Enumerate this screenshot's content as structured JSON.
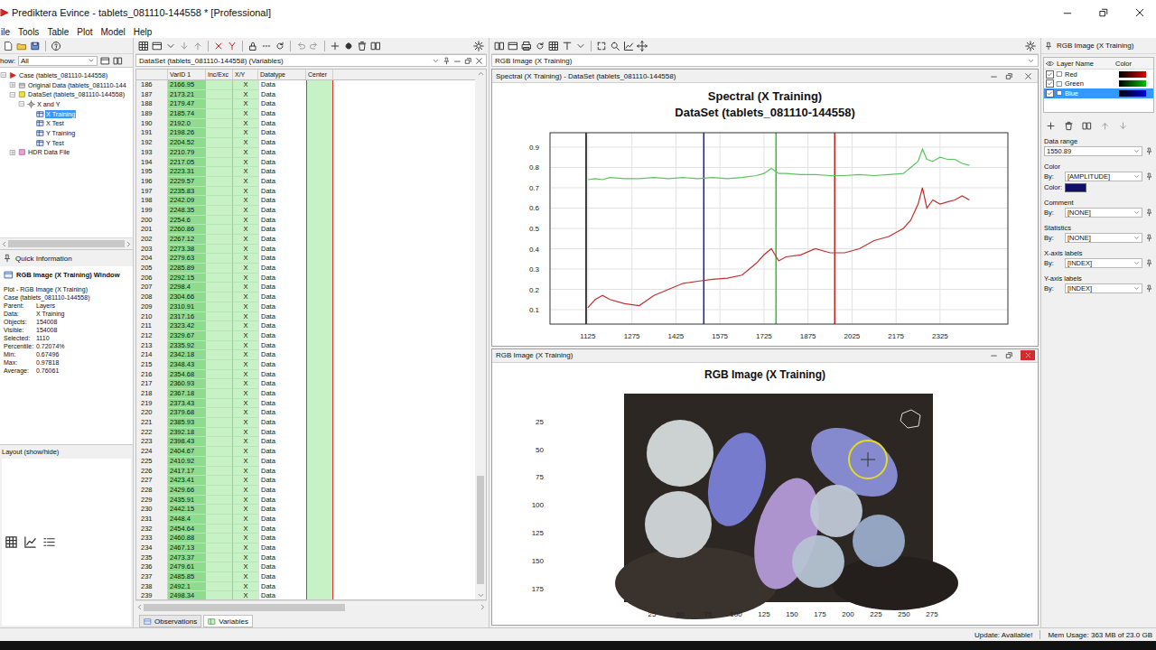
{
  "window": {
    "title": "Prediktera Evince - tablets_081110-144558 * [Professional]"
  },
  "menu": [
    "ile",
    "Tools",
    "Table",
    "Plot",
    "Model",
    "Help"
  ],
  "explorer": {
    "show_label": "how:",
    "show_value": "All",
    "tree": [
      {
        "label": "Case (tablets_081110-144558)",
        "depth": 0,
        "kind": "case",
        "expanded": true,
        "selected": false
      },
      {
        "label": "Original Data (tablets_081110-144",
        "depth": 1,
        "kind": "source",
        "expanded": false,
        "selected": false
      },
      {
        "label": "DataSet (tablets_081110-144558)",
        "depth": 1,
        "kind": "dataset",
        "expanded": true,
        "selected": false
      },
      {
        "label": "X and Y",
        "depth": 2,
        "kind": "group",
        "expanded": true,
        "selected": false
      },
      {
        "label": "X Training",
        "depth": 3,
        "kind": "matrix",
        "expanded": false,
        "selected": true
      },
      {
        "label": "X Test",
        "depth": 3,
        "kind": "matrix",
        "expanded": false,
        "selected": false
      },
      {
        "label": "Y Training",
        "depth": 3,
        "kind": "matrix",
        "expanded": false,
        "selected": false
      },
      {
        "label": "Y Test",
        "depth": 3,
        "kind": "matrix",
        "expanded": false,
        "selected": false
      },
      {
        "label": "HDR Data File",
        "depth": 1,
        "kind": "file",
        "expanded": false,
        "selected": false
      }
    ]
  },
  "quick_info": {
    "title": "Quick Information",
    "heading": "RGB Image (X Training) Window",
    "lines": [
      "Plot - RGB Image (X Training)",
      "Case (tablets_081110-144558)"
    ],
    "fields": [
      {
        "label": "Parent:",
        "value": "Layers"
      },
      {
        "label": "Data:",
        "value": "X Training"
      },
      {
        "label": "Objects:",
        "value": "154008"
      },
      {
        "label": "Visible:",
        "value": "154008"
      },
      {
        "label": "Selected:",
        "value": "1110"
      },
      {
        "label": "Percentile:",
        "value": "0.72074%"
      },
      {
        "label": "Min:",
        "value": "0.67496"
      },
      {
        "label": "Max:",
        "value": "0.97818"
      },
      {
        "label": "Average:",
        "value": "0.76061"
      }
    ]
  },
  "layout_panel": {
    "title": "Layout (show/hide)"
  },
  "grid": {
    "title": "DataSet (tablets_081110-144558) (Variables)",
    "columns": [
      "VarID 1",
      "Inc/Exc",
      "X/Y",
      "Datatype",
      "Center"
    ],
    "rows": [
      {
        "id": "186",
        "var": "2166.95",
        "xy": "X",
        "type": "Data"
      },
      {
        "id": "187",
        "var": "2173.21",
        "xy": "X",
        "type": "Data"
      },
      {
        "id": "188",
        "var": "2179.47",
        "xy": "X",
        "type": "Data"
      },
      {
        "id": "189",
        "var": "2185.74",
        "xy": "X",
        "type": "Data"
      },
      {
        "id": "190",
        "var": "2192.0",
        "xy": "X",
        "type": "Data"
      },
      {
        "id": "191",
        "var": "2198.26",
        "xy": "X",
        "type": "Data"
      },
      {
        "id": "192",
        "var": "2204.52",
        "xy": "X",
        "type": "Data"
      },
      {
        "id": "193",
        "var": "2210.79",
        "xy": "X",
        "type": "Data"
      },
      {
        "id": "194",
        "var": "2217.05",
        "xy": "X",
        "type": "Data"
      },
      {
        "id": "195",
        "var": "2223.31",
        "xy": "X",
        "type": "Data"
      },
      {
        "id": "196",
        "var": "2229.57",
        "xy": "X",
        "type": "Data"
      },
      {
        "id": "197",
        "var": "2235.83",
        "xy": "X",
        "type": "Data"
      },
      {
        "id": "198",
        "var": "2242.09",
        "xy": "X",
        "type": "Data"
      },
      {
        "id": "199",
        "var": "2248.35",
        "xy": "X",
        "type": "Data"
      },
      {
        "id": "200",
        "var": "2254.6",
        "xy": "X",
        "type": "Data"
      },
      {
        "id": "201",
        "var": "2260.86",
        "xy": "X",
        "type": "Data"
      },
      {
        "id": "202",
        "var": "2267.12",
        "xy": "X",
        "type": "Data"
      },
      {
        "id": "203",
        "var": "2273.38",
        "xy": "X",
        "type": "Data"
      },
      {
        "id": "204",
        "var": "2279.63",
        "xy": "X",
        "type": "Data"
      },
      {
        "id": "205",
        "var": "2285.89",
        "xy": "X",
        "type": "Data"
      },
      {
        "id": "206",
        "var": "2292.15",
        "xy": "X",
        "type": "Data"
      },
      {
        "id": "207",
        "var": "2298.4",
        "xy": "X",
        "type": "Data"
      },
      {
        "id": "208",
        "var": "2304.66",
        "xy": "X",
        "type": "Data"
      },
      {
        "id": "209",
        "var": "2310.91",
        "xy": "X",
        "type": "Data"
      },
      {
        "id": "210",
        "var": "2317.16",
        "xy": "X",
        "type": "Data"
      },
      {
        "id": "211",
        "var": "2323.42",
        "xy": "X",
        "type": "Data"
      },
      {
        "id": "212",
        "var": "2329.67",
        "xy": "X",
        "type": "Data"
      },
      {
        "id": "213",
        "var": "2335.92",
        "xy": "X",
        "type": "Data"
      },
      {
        "id": "214",
        "var": "2342.18",
        "xy": "X",
        "type": "Data"
      },
      {
        "id": "215",
        "var": "2348.43",
        "xy": "X",
        "type": "Data"
      },
      {
        "id": "216",
        "var": "2354.68",
        "xy": "X",
        "type": "Data"
      },
      {
        "id": "217",
        "var": "2360.93",
        "xy": "X",
        "type": "Data"
      },
      {
        "id": "218",
        "var": "2367.18",
        "xy": "X",
        "type": "Data"
      },
      {
        "id": "219",
        "var": "2373.43",
        "xy": "X",
        "type": "Data"
      },
      {
        "id": "220",
        "var": "2379.68",
        "xy": "X",
        "type": "Data"
      },
      {
        "id": "221",
        "var": "2385.93",
        "xy": "X",
        "type": "Data"
      },
      {
        "id": "222",
        "var": "2392.18",
        "xy": "X",
        "type": "Data"
      },
      {
        "id": "223",
        "var": "2398.43",
        "xy": "X",
        "type": "Data"
      },
      {
        "id": "224",
        "var": "2404.67",
        "xy": "X",
        "type": "Data"
      },
      {
        "id": "225",
        "var": "2410.92",
        "xy": "X",
        "type": "Data"
      },
      {
        "id": "226",
        "var": "2417.17",
        "xy": "X",
        "type": "Data"
      },
      {
        "id": "227",
        "var": "2423.41",
        "xy": "X",
        "type": "Data"
      },
      {
        "id": "228",
        "var": "2429.66",
        "xy": "X",
        "type": "Data"
      },
      {
        "id": "229",
        "var": "2435.91",
        "xy": "X",
        "type": "Data"
      },
      {
        "id": "230",
        "var": "2442.15",
        "xy": "X",
        "type": "Data"
      },
      {
        "id": "231",
        "var": "2448.4",
        "xy": "X",
        "type": "Data"
      },
      {
        "id": "232",
        "var": "2454.64",
        "xy": "X",
        "type": "Data"
      },
      {
        "id": "233",
        "var": "2460.88",
        "xy": "X",
        "type": "Data"
      },
      {
        "id": "234",
        "var": "2467.13",
        "xy": "X",
        "type": "Data"
      },
      {
        "id": "235",
        "var": "2473.37",
        "xy": "X",
        "type": "Data"
      },
      {
        "id": "236",
        "var": "2479.61",
        "xy": "X",
        "type": "Data"
      },
      {
        "id": "237",
        "var": "2485.85",
        "xy": "X",
        "type": "Data"
      },
      {
        "id": "238",
        "var": "2492.1",
        "xy": "X",
        "type": "Data"
      },
      {
        "id": "239",
        "var": "2498.34",
        "xy": "X",
        "type": "Data"
      }
    ],
    "tabs": [
      {
        "label": "Observations",
        "selected": false
      },
      {
        "label": "Variables",
        "selected": true
      }
    ]
  },
  "plot_area": {
    "title": "RGB Image (X Training)"
  },
  "spectral_window": {
    "title": "Spectral (X Training) - DataSet (tablets_081110-144558)",
    "active": false,
    "chart": {
      "title": [
        "Spectral (X Training)",
        "DataSet (tablets_081110-144558)"
      ],
      "x_ticks": [
        "1125",
        "1275",
        "1425",
        "1575",
        "1725",
        "1875",
        "2025",
        "2175",
        "2325"
      ],
      "y_ticks": [
        "0.1",
        "0.2",
        "0.3",
        "0.4",
        "0.5",
        "0.6",
        "0.7",
        "0.8",
        "0.9"
      ],
      "markers": [
        {
          "value": 1119,
          "color": "#000000"
        },
        {
          "value": 1520,
          "color": "#1a1aa0"
        },
        {
          "value": 1766,
          "color": "#22cc22"
        },
        {
          "value": 1966,
          "color": "#cc2222"
        }
      ],
      "x_values": [
        1125,
        1150,
        1175,
        1200,
        1250,
        1300,
        1350,
        1400,
        1450,
        1500,
        1550,
        1600,
        1650,
        1700,
        1725,
        1750,
        1775,
        1800,
        1850,
        1900,
        1950,
        2000,
        2050,
        2100,
        2150,
        2200,
        2225,
        2250,
        2265,
        2280,
        2300,
        2325,
        2350,
        2375,
        2400,
        2425
      ],
      "series": [
        {
          "name": "green",
          "color": "#5cc45c",
          "values": [
            0.74,
            0.745,
            0.74,
            0.75,
            0.745,
            0.745,
            0.75,
            0.745,
            0.75,
            0.745,
            0.75,
            0.745,
            0.75,
            0.76,
            0.77,
            0.795,
            0.77,
            0.77,
            0.765,
            0.765,
            0.76,
            0.76,
            0.765,
            0.76,
            0.765,
            0.77,
            0.8,
            0.83,
            0.89,
            0.84,
            0.83,
            0.85,
            0.84,
            0.84,
            0.82,
            0.81
          ]
        },
        {
          "name": "red",
          "color": "#c03030",
          "values": [
            0.11,
            0.15,
            0.17,
            0.15,
            0.13,
            0.12,
            0.17,
            0.2,
            0.23,
            0.24,
            0.25,
            0.255,
            0.27,
            0.33,
            0.37,
            0.4,
            0.34,
            0.36,
            0.37,
            0.4,
            0.38,
            0.38,
            0.4,
            0.44,
            0.46,
            0.5,
            0.54,
            0.62,
            0.7,
            0.6,
            0.64,
            0.62,
            0.63,
            0.64,
            0.66,
            0.64
          ]
        }
      ]
    }
  },
  "rgb_window": {
    "title": "RGB Image (X Training)",
    "active": true,
    "plot_title": "RGB Image (X Training)",
    "x_ticks": [
      "25",
      "50",
      "75",
      "100",
      "125",
      "150",
      "175",
      "200",
      "225",
      "250",
      "275"
    ],
    "y_ticks": [
      "25",
      "50",
      "75",
      "100",
      "125",
      "150",
      "175"
    ],
    "tablets": [
      {
        "kind": "round",
        "color": "#d5dadc"
      },
      {
        "kind": "round",
        "color": "#d2d7da"
      },
      {
        "kind": "oblong",
        "color": "#7a7fd8"
      },
      {
        "kind": "oblong",
        "color": "#b49ad8"
      },
      {
        "kind": "oblong",
        "color": "#8a8fd8"
      },
      {
        "kind": "round",
        "color": "#bfc8d6"
      },
      {
        "kind": "round",
        "color": "#b5c3d3"
      },
      {
        "kind": "round",
        "color": "#9aaccb"
      }
    ]
  },
  "layer_panel": {
    "title": "RGB Image (X Training)",
    "columns": [
      "Layer Name",
      "Color"
    ],
    "layers": [
      {
        "name": "Red",
        "checked": true,
        "selected": false,
        "color": "#e00000"
      },
      {
        "name": "Green",
        "checked": true,
        "selected": false,
        "color": "#00c000"
      },
      {
        "name": "Blue",
        "checked": true,
        "selected": true,
        "color": "#0000e0"
      }
    ],
    "properties": [
      {
        "label": "Data range",
        "rows": [
          {
            "kind": "field",
            "value": "1550.89"
          }
        ]
      },
      {
        "label": "Color",
        "rows": [
          {
            "kind": "field",
            "label": "By:",
            "value": "[AMPLITUDE]"
          },
          {
            "kind": "swatch",
            "label": "Color:",
            "color": "#10106a"
          }
        ]
      },
      {
        "label": "Comment",
        "rows": [
          {
            "kind": "field",
            "label": "By:",
            "value": "[NONE]"
          }
        ]
      },
      {
        "label": "Statistics",
        "rows": [
          {
            "kind": "field",
            "label": "By:",
            "value": "[NONE]"
          }
        ]
      },
      {
        "label": "X-axis labels",
        "rows": [
          {
            "kind": "field",
            "label": "By:",
            "value": "[INDEX]"
          }
        ]
      },
      {
        "label": "Y-axis labels",
        "rows": [
          {
            "kind": "field",
            "label": "By:",
            "value": "[INDEX]"
          }
        ]
      }
    ]
  },
  "status_bar": {
    "update": "Update: Available!",
    "memory": "Mem Usage: 363 MB of 23.0 GB"
  }
}
